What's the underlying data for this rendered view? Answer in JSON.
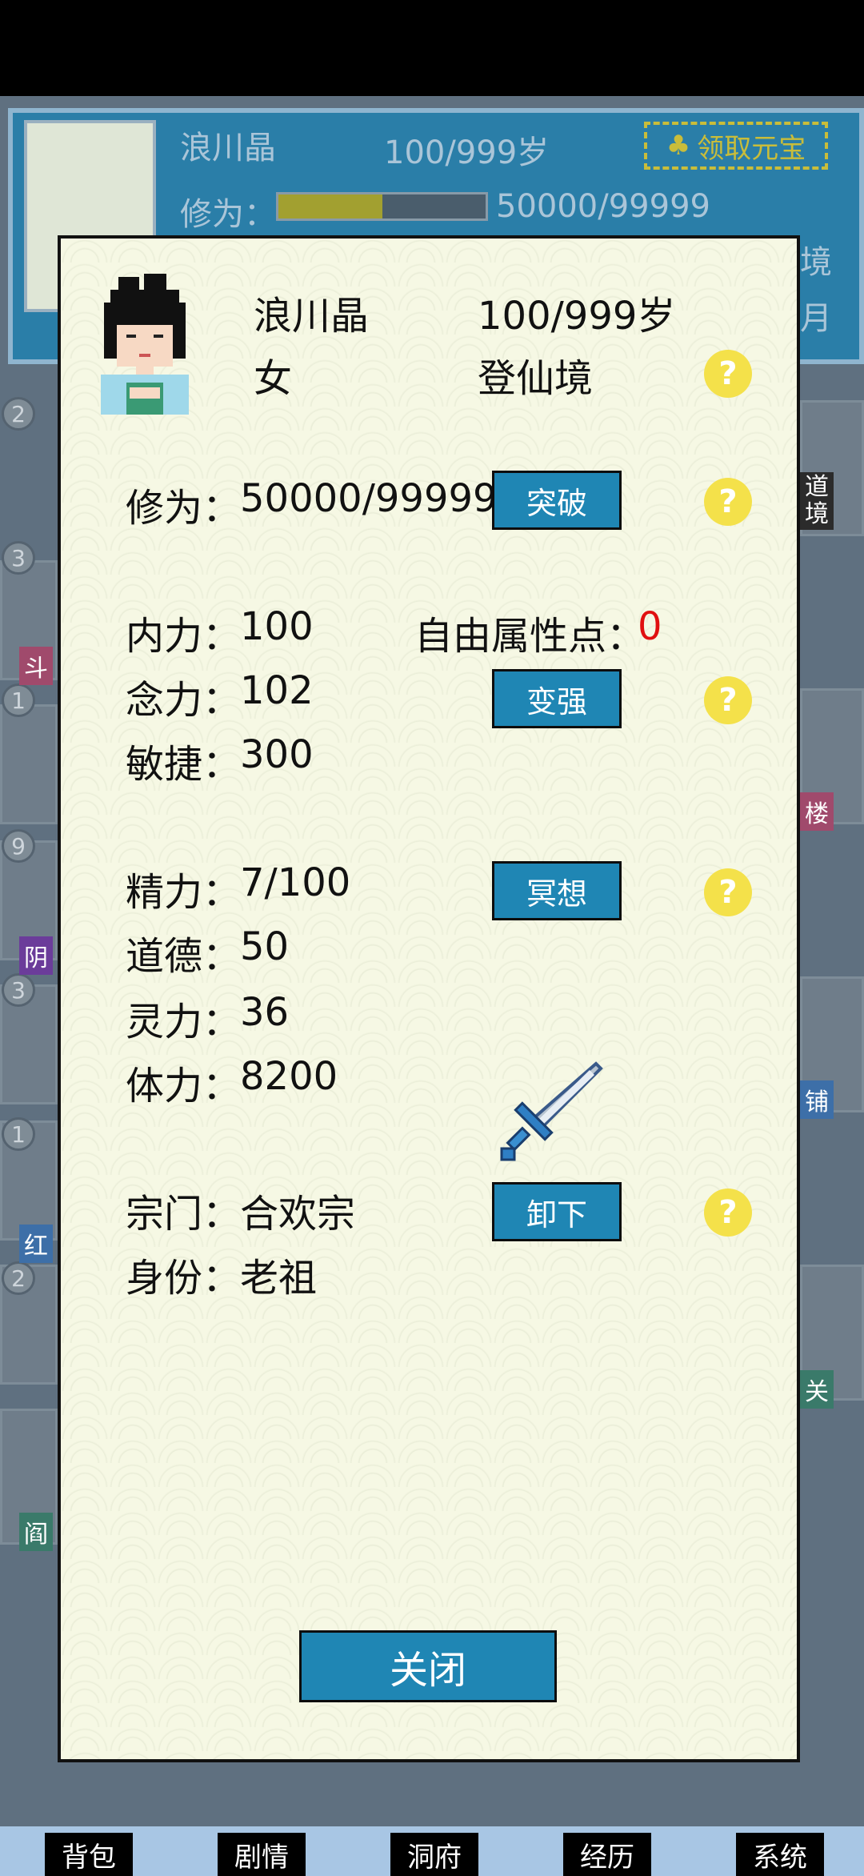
{
  "background": {
    "name": "浪川晶",
    "age": "100/999岁",
    "cultivation_label": "修为：",
    "cultivation_value": "50000/99999",
    "cultivation_progress": 0.5,
    "reward_button": "领取元宝",
    "right_text_1": "境",
    "right_text_2": "月",
    "side_badges": [
      "2",
      "3",
      "1",
      "9",
      "3",
      "1",
      "2"
    ],
    "side_tags": [
      "斗",
      "阴",
      "红",
      "阎"
    ],
    "right_tags": [
      "道\n境",
      "楼",
      "铺",
      "关"
    ]
  },
  "dialog": {
    "name": "浪川晶",
    "age": "100/999岁",
    "gender": "女",
    "realm": "登仙境",
    "cultivation_label": "修为：",
    "cultivation_value": "50000/99999",
    "breakthrough_button": "突破",
    "inner_power_label": "内力：",
    "inner_power_value": "100",
    "free_points_label": "自由属性点：",
    "free_points_value": "0",
    "mind_power_label": "念力：",
    "mind_power_value": "102",
    "strengthen_button": "变强",
    "agility_label": "敏捷：",
    "agility_value": "300",
    "energy_label": "精力：",
    "energy_value": "7/100",
    "meditate_button": "冥想",
    "morality_label": "道德：",
    "morality_value": "50",
    "spirit_label": "灵力：",
    "spirit_value": "36",
    "stamina_label": "体力：",
    "stamina_value": "8200",
    "sect_label": "宗门：",
    "sect_value": "合欢宗",
    "unequip_button": "卸下",
    "identity_label": "身份：",
    "identity_value": "老祖",
    "close_button": "关闭",
    "help_symbol": "?"
  },
  "bottom_nav": [
    "背包",
    "剧情",
    "洞府",
    "经历",
    "系统"
  ],
  "colors": {
    "button_blue": "#1f86b4",
    "free_points_red": "#e01010",
    "help_yellow": "#f4e14a",
    "dialog_bg": "#f6f8e4"
  }
}
